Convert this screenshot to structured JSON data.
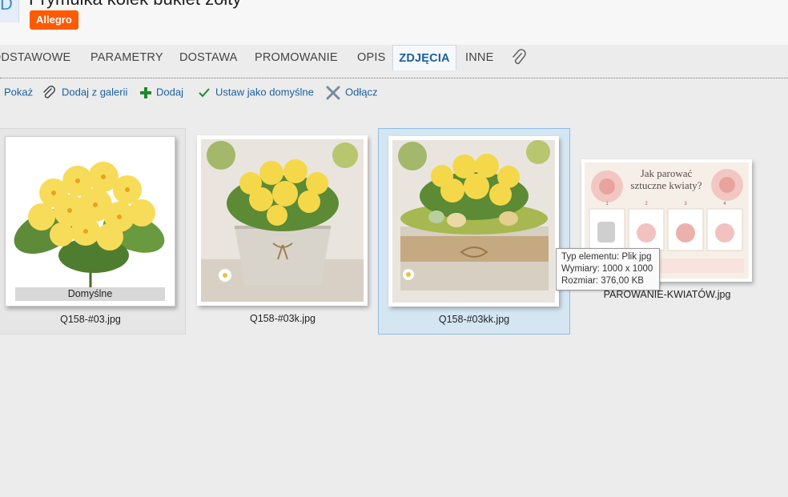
{
  "header": {
    "icon_glyph": "D",
    "title": "Prymulka kolek bukiet żółty",
    "badge": "Allegro",
    "badge_color": "#ff5a00"
  },
  "tabs": [
    {
      "label": "PODSTAWOWE"
    },
    {
      "label": "PARAMETRY"
    },
    {
      "label": "DOSTAWA"
    },
    {
      "label": "PROMOWANIE"
    },
    {
      "label": "OPIS"
    },
    {
      "label": "ZDJĘCIA",
      "active": true
    },
    {
      "label": "INNE"
    },
    {
      "icon": "paperclip-icon"
    }
  ],
  "toolbar": {
    "show": "Pokaż",
    "add_from_gallery": "Dodaj z galerii",
    "add": "Dodaj",
    "set_default": "Ustaw jako domyślne",
    "detach": "Odłącz"
  },
  "images": [
    {
      "filename": "Q158-#03.jpg",
      "default_label": "Domyślne"
    },
    {
      "filename": "Q158-#03k.jpg"
    },
    {
      "filename": "Q158-#03kk.jpg",
      "selected": true
    },
    {
      "filename": "PAROWANIE-KWIATÓW.jpg"
    }
  ],
  "infographic": {
    "title_line1": "Jak parować",
    "title_line2": "sztuczne kwiaty?",
    "steps": [
      "1",
      "2",
      "3",
      "4"
    ]
  },
  "tooltip": {
    "type": "Typ elementu: Plik jpg",
    "dimensions": "Wymiary: 1000 x 1000",
    "size": "Rozmiar: 376,00 KB"
  }
}
